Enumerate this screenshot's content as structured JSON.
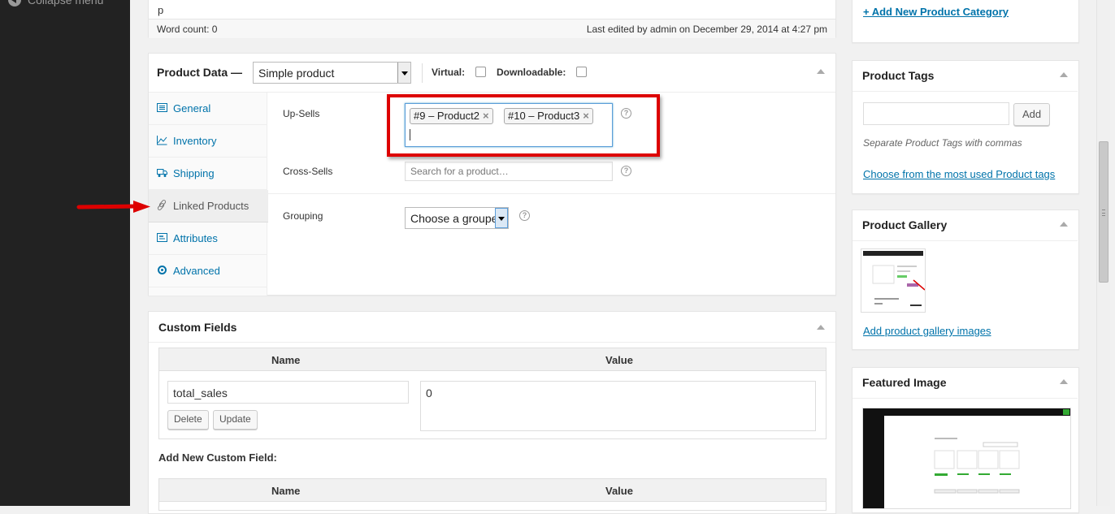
{
  "sidebar": {
    "collapse_label": "Collapse menu"
  },
  "editor": {
    "path": "p",
    "word_count": "Word count: 0",
    "last_edited": "Last edited by admin on December 29, 2014 at 4:27 pm"
  },
  "product_data": {
    "title": "Product Data —",
    "product_type": "Simple product",
    "virtual_label": "Virtual:",
    "virtual_checked": false,
    "downloadable_label": "Downloadable:",
    "downloadable_checked": false,
    "tabs": [
      {
        "label": "General",
        "icon": "general-icon"
      },
      {
        "label": "Inventory",
        "icon": "inventory-icon"
      },
      {
        "label": "Shipping",
        "icon": "truck-icon"
      },
      {
        "label": "Linked Products",
        "icon": "link-icon",
        "active": true
      },
      {
        "label": "Attributes",
        "icon": "attributes-icon"
      },
      {
        "label": "Advanced",
        "icon": "gear-icon"
      }
    ],
    "upsells_label": "Up-Sells",
    "upsells_tokens": [
      "#9 – Product2",
      "#10 – Product3"
    ],
    "token_remove": "×",
    "crosssells_label": "Cross-Sells",
    "crosssells_placeholder": "Search for a product…",
    "grouping_label": "Grouping",
    "grouping_value": "Choose a grouped product…",
    "help_glyph": "?"
  },
  "custom_fields": {
    "title": "Custom Fields",
    "col_name": "Name",
    "col_value": "Value",
    "key": "total_sales",
    "value": "0",
    "delete_label": "Delete",
    "update_label": "Update",
    "add_new_label": "Add New Custom Field:",
    "col_name_2": "Name",
    "col_value_2": "Value"
  },
  "right": {
    "add_category": "+ Add New Product Category",
    "tags_title": "Product Tags",
    "tags_add": "Add",
    "tags_hint": "Separate Product Tags with commas",
    "tags_choose": "Choose from the most used Product tags",
    "gallery_title": "Product Gallery",
    "gallery_link": "Add product gallery images",
    "featured_title": "Featured Image"
  },
  "colors": {
    "accent": "#0073aa",
    "highlight": "#dd0000",
    "sidebar": "#222222"
  }
}
